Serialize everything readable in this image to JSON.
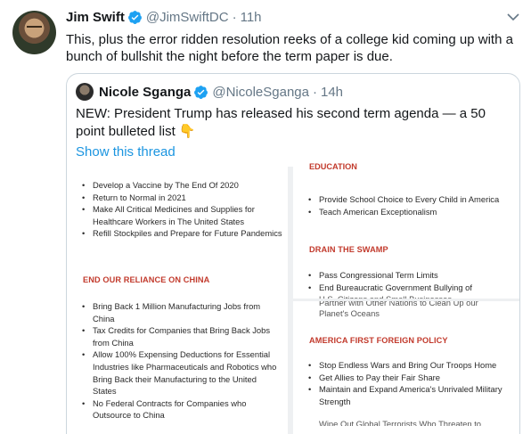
{
  "tweet": {
    "author_name": "Jim Swift",
    "author_handle": "@JimSwiftDC",
    "separator": "·",
    "time": "11h",
    "text": "This, plus the error ridden resolution reeks of a college kid coming up with a bunch of bullshit the night before the term paper is due."
  },
  "quoted": {
    "author_name": "Nicole Sganga",
    "author_handle": "@NicoleSganga",
    "separator": "·",
    "time": "14h",
    "text": "NEW: President Trump has released his second term agenda — a 50 point bulleted list 👇",
    "show_thread": "Show this thread"
  },
  "document": {
    "left": {
      "top_items": [
        "Develop a Vaccine by The End Of 2020",
        "Return to Normal in 2021",
        "Make All Critical Medicines and Supplies for Healthcare Workers in The United States",
        "Refill Stockpiles and Prepare for Future Pandemics"
      ],
      "section_title": "END OUR RELIANCE ON CHINA",
      "section_items": [
        "Bring Back 1 Million Manufacturing Jobs from China",
        "Tax Credits for Companies that Bring Back Jobs from China",
        "Allow 100% Expensing Deductions for Essential Industries like Pharmaceuticals and Robotics who Bring Back their Manufacturing to the United States",
        "No Federal Contracts for Companies who Outsource to China"
      ]
    },
    "right": {
      "cut_heading": "EDUCATION",
      "top_items": [
        "Provide School Choice to Every Child in America",
        "Teach American Exceptionalism"
      ],
      "section1_title": "DRAIN THE SWAMP",
      "section1_items": [
        "Pass Congressional Term Limits",
        "End Bureaucratic Government Bullying of"
      ],
      "cut_line_a": "U.S. Citizens and Small Businesses",
      "cut_line_b": "Partner with Other Nations to Clean Up our",
      "continued_line": "Planet's Oceans",
      "section2_title": "AMERICA FIRST FOREIGN POLICY",
      "section2_items": [
        "Stop Endless Wars and Bring Our Troops Home",
        "Get Allies to Pay their Fair Share",
        "Maintain and Expand America's Unrivaled Military Strength"
      ],
      "cut_line_c": "Wipe Out Global Terrorists Who Threaten to"
    }
  },
  "colors": {
    "link": "#1b95e0",
    "verified": "#1da1f2",
    "secondary_text": "#657786",
    "section_heading": "#c23a2c"
  },
  "icons": {
    "verified": "verified-badge-icon",
    "caret": "chevron-down-icon"
  }
}
